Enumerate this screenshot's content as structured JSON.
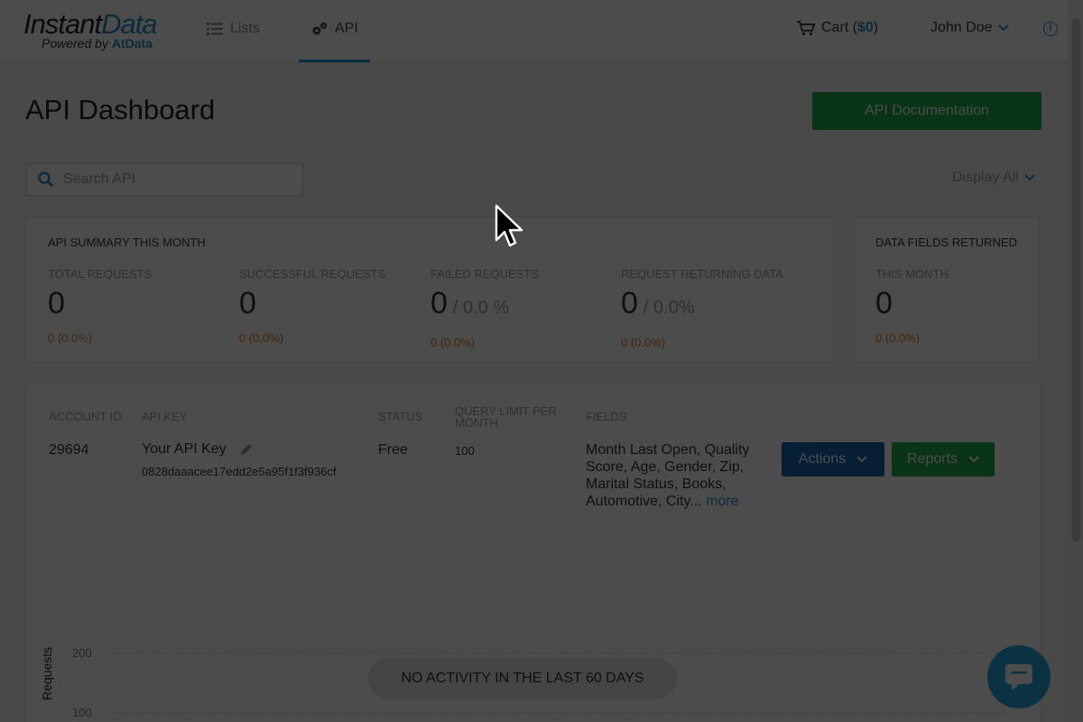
{
  "header": {
    "logo_instant": "Instant",
    "logo_data": "Data",
    "logo_powered": "Powered by ",
    "logo_atdata": "AtData",
    "nav": [
      {
        "label": "Lists"
      },
      {
        "label": "API"
      }
    ],
    "cart_label": "Cart (",
    "cart_amount": "$0",
    "cart_close": ")",
    "user_name": "John Doe"
  },
  "page": {
    "title": "API Dashboard",
    "doc_button": "API Documentation",
    "search_placeholder": "Search API",
    "display_all": "Display All"
  },
  "summary": {
    "title": "API SUMMARY THIS MONTH",
    "stats": [
      {
        "label": "TOTAL REQUESTS",
        "value": "0",
        "pct": "",
        "change": "0 (0.0%)"
      },
      {
        "label": "SUCCESSFUL REQUESTS",
        "value": "0",
        "pct": "",
        "change": "0 (0.0%)"
      },
      {
        "label": "FAILED REQUESTS",
        "value": "0",
        "pct": "/ 0.0 %",
        "change": "0 (0.0%)"
      },
      {
        "label": "REQUEST RETURNING DATA",
        "value": "0",
        "pct": "/ 0.0%",
        "change": "0 (0.0%)"
      }
    ]
  },
  "fields_card": {
    "title": "DATA FIELDS RETURNED",
    "label": "THIS MONTH",
    "value": "0",
    "change": "0 (0.0%)"
  },
  "account": {
    "headers": {
      "account_id": "ACCOUNT ID",
      "api_key": "API KEY",
      "status": "STATUS",
      "query_limit": "QUERY LIMIT PER MONTH",
      "fields": "FIELDS"
    },
    "account_id": "29694",
    "api_key_name": "Your API Key",
    "api_key_value": "0828daaacee17edd2e5a95f1f3f936cf",
    "status": "Free",
    "query_limit": "100",
    "fields": "Month Last Open, Quality Score, Age, Gender, Zip, Marital Status, Books, Automotive, City...",
    "fields_more": " more",
    "actions_button": "Actions",
    "reports_button": "Reports"
  },
  "chart": {
    "y_label": "Requests",
    "ticks": [
      "200",
      "100"
    ],
    "no_activity": "NO ACTIVITY IN THE LAST 60 DAYS"
  },
  "colors": {
    "accent": "#1f8fc9",
    "green": "#1fae4b",
    "blue_button": "#1669ad",
    "orange": "#e07b1a"
  }
}
